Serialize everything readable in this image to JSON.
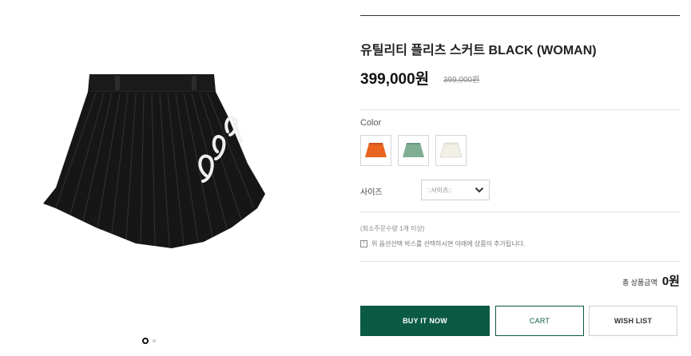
{
  "product": {
    "title": "유틸리티 플리츠 스커트 BLACK (WOMAN)",
    "price": "399,000원",
    "original_price": "399,000원"
  },
  "gallery": {
    "image_alt": "black pleated skirt",
    "dot_count": 2,
    "active_dot": 0
  },
  "options": {
    "color_label": "Color",
    "colors": [
      {
        "name": "orange",
        "hex": "#e8641f"
      },
      {
        "name": "sage-green",
        "hex": "#7fae94"
      },
      {
        "name": "ivory",
        "hex": "#f1efe6"
      }
    ],
    "size_label": "사이즈",
    "size_select_value": "::사이즈::"
  },
  "notes": {
    "min_qty": "(최소주문수량 1개 이상)",
    "notice_icon": "!",
    "notice": "위 옵션선택 박스를 선택하시면 아래에 상품이 추가됩니다."
  },
  "summary": {
    "total_label": "총 상품금액",
    "total_value": "0원"
  },
  "actions": {
    "buy_label": "BUY IT NOW",
    "cart_label": "CART",
    "wish_label": "WISH LIST"
  },
  "colors": {
    "brand_green": "#0b5a44",
    "skirt": "#1a1a1a"
  }
}
